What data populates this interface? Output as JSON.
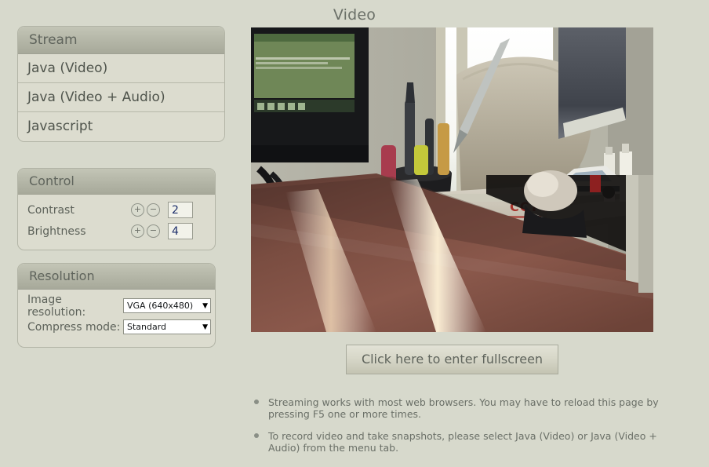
{
  "page": {
    "title": "Video",
    "background_color": "#d7d9cc",
    "accent_color": "#a7a99a"
  },
  "stream": {
    "header": "Stream",
    "items": [
      {
        "label": "Java (Video)"
      },
      {
        "label": "Java (Video + Audio)"
      },
      {
        "label": "Javascript"
      }
    ]
  },
  "control": {
    "header": "Control",
    "rows": [
      {
        "label": "Contrast",
        "value": "2",
        "plus": "+",
        "minus": "−"
      },
      {
        "label": "Brightness",
        "value": "4",
        "plus": "+",
        "minus": "−"
      }
    ]
  },
  "resolution": {
    "header": "Resolution",
    "rows": [
      {
        "label": "Image resolution:",
        "value": "VGA (640x480)",
        "arrow": "▼"
      },
      {
        "label": "Compress mode:",
        "value": "Standard",
        "arrow": "▼"
      }
    ]
  },
  "video": {
    "alt": "live-camera-stream",
    "fullscreen_button": "Click here to enter fullscreen"
  },
  "notes": [
    {
      "text": "Streaming works with most web browsers. You may have to reload this page by pressing F5 one or more times."
    },
    {
      "text": "To record video and take snapshots, please select Java (Video) or Java (Video + Audio) from the menu tab."
    }
  ]
}
